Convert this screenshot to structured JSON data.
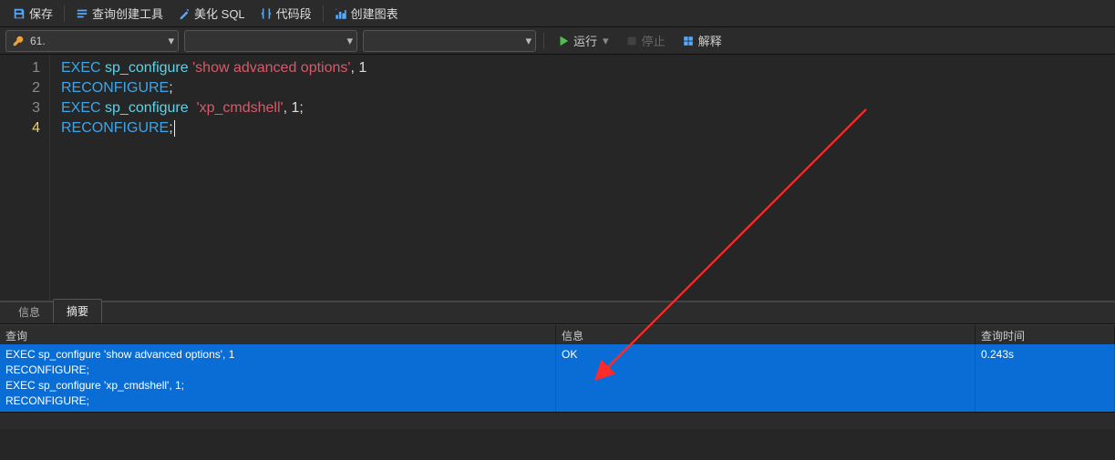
{
  "toolbar": {
    "save": "保存",
    "queryBuilder": "查询创建工具",
    "beautifySql": "美化 SQL",
    "snippet": "代码段",
    "createChart": "创建图表"
  },
  "toolbar2": {
    "connection": "61.",
    "run": "运行",
    "stop": "停止",
    "explain": "解释"
  },
  "editor": {
    "lines": [
      {
        "n": "1",
        "tokens": [
          {
            "t": "EXEC",
            "c": "kw"
          },
          {
            "t": " ",
            "c": "punc"
          },
          {
            "t": "sp_configure",
            "c": "id"
          },
          {
            "t": " ",
            "c": "punc"
          },
          {
            "t": "'show advanced options'",
            "c": "str"
          },
          {
            "t": ", ",
            "c": "punc"
          },
          {
            "t": "1",
            "c": "num"
          }
        ]
      },
      {
        "n": "2",
        "tokens": [
          {
            "t": "RECONFIGURE",
            "c": "kw"
          },
          {
            "t": ";",
            "c": "punc"
          }
        ]
      },
      {
        "n": "3",
        "tokens": [
          {
            "t": "EXEC",
            "c": "kw"
          },
          {
            "t": " ",
            "c": "punc"
          },
          {
            "t": "sp_configure",
            "c": "id"
          },
          {
            "t": "  ",
            "c": "punc"
          },
          {
            "t": "'xp_cmdshell'",
            "c": "str"
          },
          {
            "t": ", ",
            "c": "punc"
          },
          {
            "t": "1",
            "c": "num"
          },
          {
            "t": ";",
            "c": "punc"
          }
        ]
      },
      {
        "n": "4",
        "tokens": [
          {
            "t": "RECONFIGURE",
            "c": "kw"
          },
          {
            "t": ";",
            "c": "punc"
          }
        ],
        "caret": true
      }
    ]
  },
  "resultTabs": {
    "info": "信息",
    "summary": "摘要"
  },
  "resultHeader": {
    "query": "查询",
    "info": "信息",
    "time": "查询时间"
  },
  "resultRow": {
    "query": "EXEC sp_configure 'show advanced options', 1\nRECONFIGURE;\nEXEC sp_configure  'xp_cmdshell', 1;\nRECONFIGURE;",
    "info": "OK",
    "time": "0.243s"
  }
}
